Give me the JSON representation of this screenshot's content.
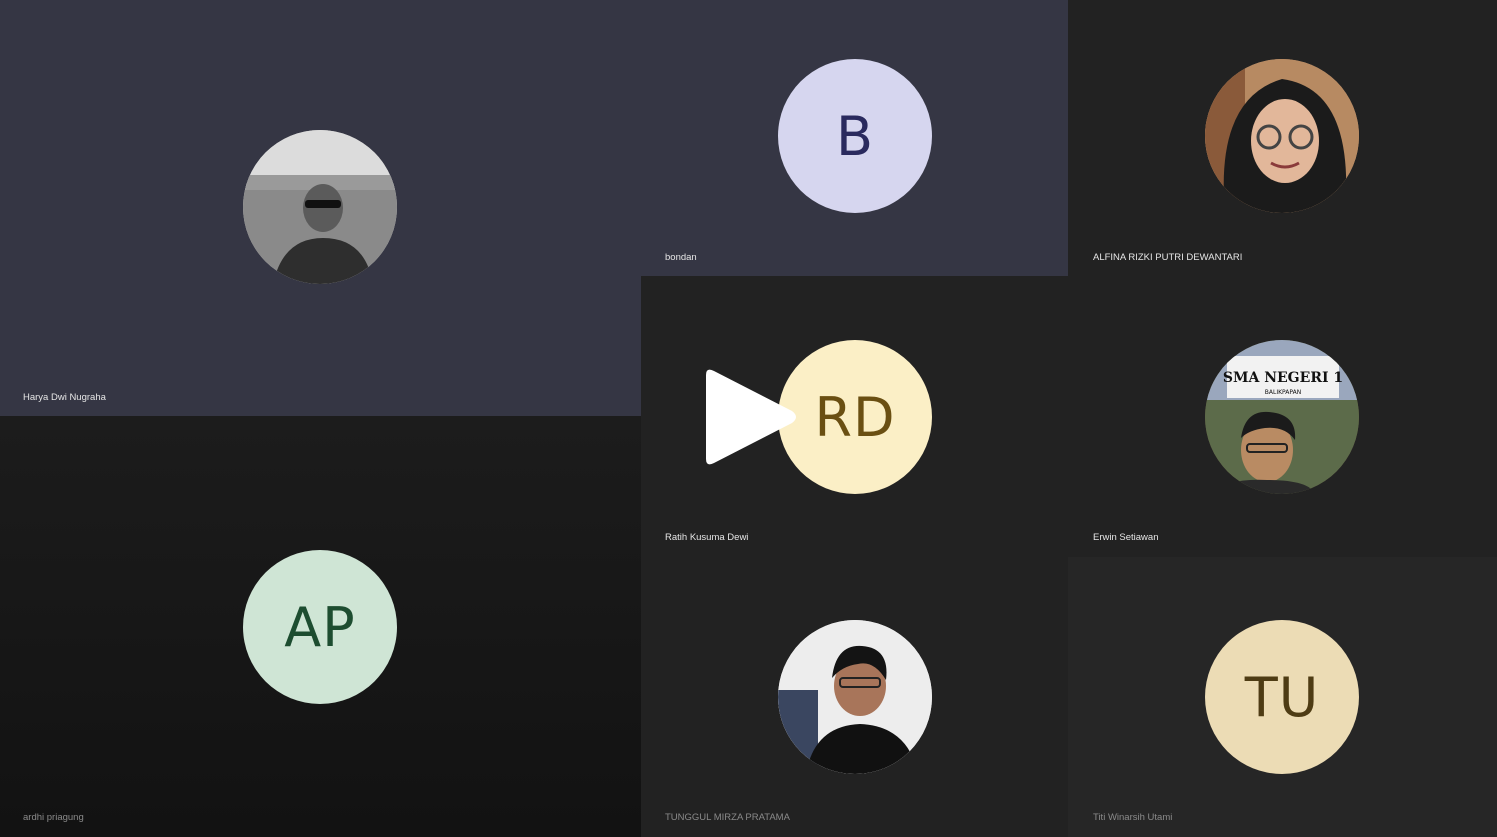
{
  "meeting": {
    "participants": [
      {
        "name": "Harya Dwi Nugraha",
        "avatar": "photo"
      },
      {
        "name": "bondan",
        "initials": "B",
        "avatar_bg": "#d6d6ef",
        "initials_color": "#2a2a5e"
      },
      {
        "name": "ALFINA RIZKI PUTRI DEWANTARI",
        "avatar": "photo"
      },
      {
        "name": "Ratih Kusuma Dewi",
        "initials": "RD",
        "avatar_bg": "#fbefc6",
        "initials_color": "#6a4f12"
      },
      {
        "name": "Erwin Setiawan",
        "avatar": "photo",
        "photo_sign_text": "SMA NEGERI 1",
        "photo_sign_subtext": "BALIKPAPAN"
      },
      {
        "name": "ardhi priagung",
        "initials": "AP",
        "avatar_bg": "#cfe5d5",
        "initials_color": "#1d4d30"
      },
      {
        "name": "TUNGGUL MIRZA PRATAMA",
        "avatar": "photo"
      },
      {
        "name": "Titi Winarsih Utami",
        "initials": "TU",
        "avatar_bg": "#ecdcb5",
        "initials_color": "#4e3c14"
      }
    ]
  },
  "overlay": {
    "play_icon": "play-icon"
  },
  "colors": {
    "active_tile_bg": "#353644",
    "tile_bg": "#222222",
    "tile_bg_dark": "#1a1a1a"
  }
}
